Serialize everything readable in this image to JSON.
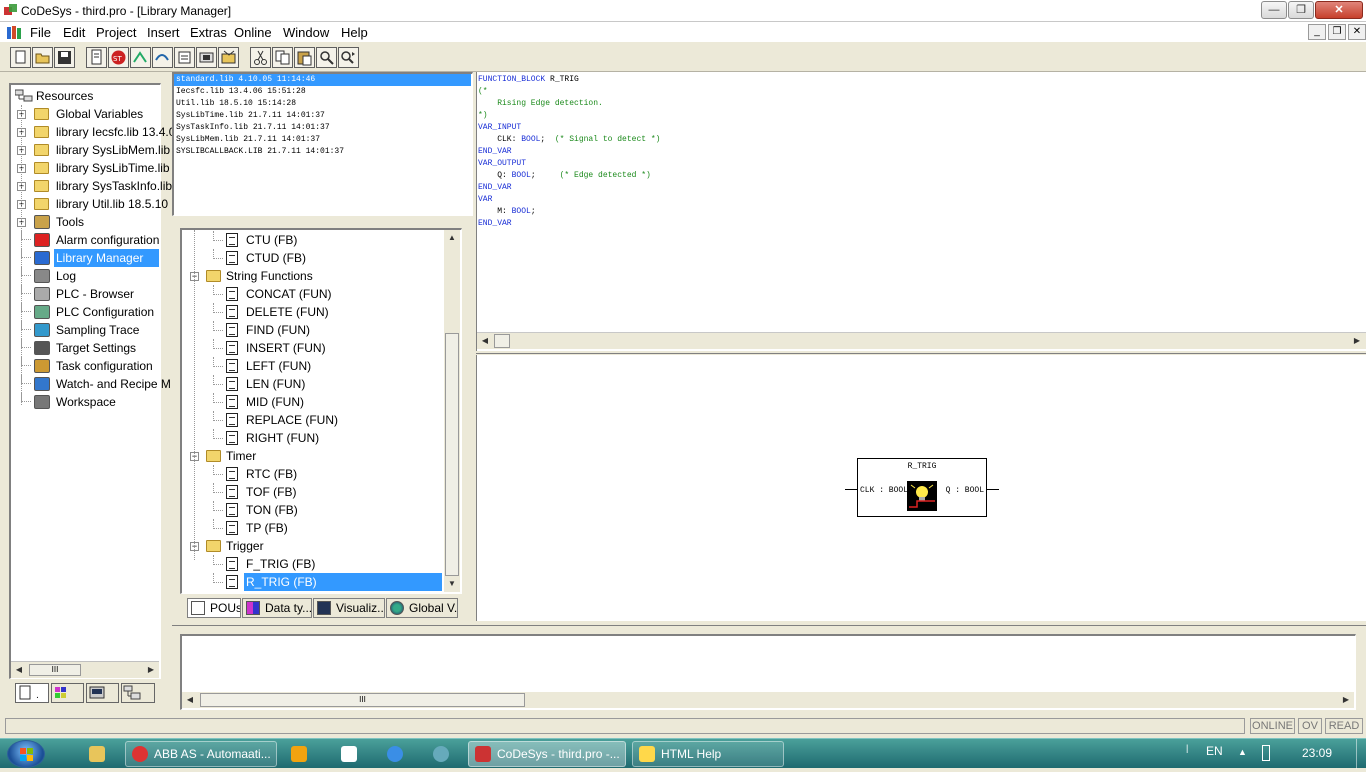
{
  "window": {
    "title": "CoDeSys - third.pro - [Library Manager]",
    "minimize_label": "—",
    "restore_label": "❐",
    "close_label": "✕"
  },
  "menubar": {
    "items": [
      "File",
      "Edit",
      "Project",
      "Insert",
      "Extras",
      "Online",
      "Window",
      "Help"
    ],
    "mdi_minimize": "_",
    "mdi_restore": "❐",
    "mdi_close": "✕"
  },
  "toolbar": {
    "buttons": [
      "new-file",
      "open-file",
      "save",
      "compile",
      "stop",
      "step-in",
      "step-over",
      "breakpoint",
      "toggle-breakpoint",
      "cut",
      "copy",
      "paste",
      "find",
      "find-next"
    ]
  },
  "resources": {
    "root_label": "Resources",
    "items": [
      {
        "label": "Global Variables",
        "expandable": true,
        "icon": "folder-icon"
      },
      {
        "label": "library Iecsfc.lib 13.4.0",
        "expandable": true,
        "icon": "folder-icon"
      },
      {
        "label": "library SysLibMem.lib 2",
        "expandable": true,
        "icon": "folder-icon"
      },
      {
        "label": "library SysLibTime.lib 2",
        "expandable": true,
        "icon": "folder-icon"
      },
      {
        "label": "library SysTaskInfo.lib",
        "expandable": true,
        "icon": "folder-icon"
      },
      {
        "label": "library Util.lib 18.5.10 1",
        "expandable": true,
        "icon": "folder-icon"
      },
      {
        "label": "Tools",
        "expandable": true,
        "icon": "tools-icon"
      },
      {
        "label": "Alarm configuration",
        "expandable": false,
        "icon": "alarm-icon"
      },
      {
        "label": "Library Manager",
        "expandable": false,
        "icon": "library-icon",
        "selected": true
      },
      {
        "label": "Log",
        "expandable": false,
        "icon": "log-icon"
      },
      {
        "label": "PLC - Browser",
        "expandable": false,
        "icon": "browser-icon"
      },
      {
        "label": "PLC Configuration",
        "expandable": false,
        "icon": "plc-config-icon"
      },
      {
        "label": "Sampling Trace",
        "expandable": false,
        "icon": "trace-icon"
      },
      {
        "label": "Target Settings",
        "expandable": false,
        "icon": "target-icon"
      },
      {
        "label": "Task configuration",
        "expandable": false,
        "icon": "task-icon"
      },
      {
        "label": "Watch- and Recipe M",
        "expandable": false,
        "icon": "watch-icon"
      },
      {
        "label": "Workspace",
        "expandable": false,
        "icon": "workspace-icon"
      }
    ],
    "hscroll_grip": "III"
  },
  "libraries": [
    "standard.lib 4.10.05 11:14:46",
    "Iecsfc.lib 13.4.06 15:51:28",
    "Util.lib 18.5.10 15:14:28",
    "SysLibTime.lib 21.7.11 14:01:37",
    "SysTaskInfo.lib 21.7.11 14:01:37",
    "SysLibMem.lib 21.7.11 14:01:37",
    "SYSLIBCALLBACK.LIB 21.7.11 14:01:37"
  ],
  "pou_tree": [
    {
      "kind": "item",
      "label": "CTU (FB)"
    },
    {
      "kind": "item",
      "label": "CTUD (FB)"
    },
    {
      "kind": "folder",
      "label": "String Functions"
    },
    {
      "kind": "item",
      "label": "CONCAT (FUN)"
    },
    {
      "kind": "item",
      "label": "DELETE (FUN)"
    },
    {
      "kind": "item",
      "label": "FIND (FUN)"
    },
    {
      "kind": "item",
      "label": "INSERT (FUN)"
    },
    {
      "kind": "item",
      "label": "LEFT (FUN)"
    },
    {
      "kind": "item",
      "label": "LEN (FUN)"
    },
    {
      "kind": "item",
      "label": "MID (FUN)"
    },
    {
      "kind": "item",
      "label": "REPLACE (FUN)"
    },
    {
      "kind": "item",
      "label": "RIGHT (FUN)"
    },
    {
      "kind": "folder",
      "label": "Timer"
    },
    {
      "kind": "item",
      "label": "RTC (FB)"
    },
    {
      "kind": "item",
      "label": "TOF (FB)"
    },
    {
      "kind": "item",
      "label": "TON (FB)"
    },
    {
      "kind": "item",
      "label": "TP (FB)"
    },
    {
      "kind": "folder",
      "label": "Trigger"
    },
    {
      "kind": "item",
      "label": "F_TRIG (FB)"
    },
    {
      "kind": "item",
      "label": "R_TRIG (FB)",
      "selected": true
    }
  ],
  "bottom_tabs": [
    "POUs",
    "Data ty...",
    "Visualiz...",
    "Global V..."
  ],
  "code": [
    [
      {
        "t": "FUNCTION_BLOCK",
        "c": "kw"
      },
      {
        "t": " R_TRIG",
        "c": ""
      }
    ],
    [
      {
        "t": "(*",
        "c": "cm"
      }
    ],
    [
      {
        "t": "    Rising Edge detection.",
        "c": "cm"
      }
    ],
    [
      {
        "t": "*)",
        "c": "cm"
      }
    ],
    [
      {
        "t": "VAR_INPUT",
        "c": "kw"
      }
    ],
    [
      {
        "t": "    CLK: ",
        "c": ""
      },
      {
        "t": "BOOL",
        "c": "kw"
      },
      {
        "t": ";  ",
        "c": ""
      },
      {
        "t": "(* Signal to detect *)",
        "c": "cm"
      }
    ],
    [
      {
        "t": "END_VAR",
        "c": "kw"
      }
    ],
    [
      {
        "t": "VAR_OUTPUT",
        "c": "kw"
      }
    ],
    [
      {
        "t": "    Q: ",
        "c": ""
      },
      {
        "t": "BOOL",
        "c": "kw"
      },
      {
        "t": ";     ",
        "c": ""
      },
      {
        "t": "(* Edge detected *)",
        "c": "cm"
      }
    ],
    [
      {
        "t": "END_VAR",
        "c": "kw"
      }
    ],
    [
      {
        "t": "VAR",
        "c": "kw"
      }
    ],
    [
      {
        "t": "    M: ",
        "c": ""
      },
      {
        "t": "BOOL",
        "c": "kw"
      },
      {
        "t": ";",
        "c": ""
      }
    ],
    [
      {
        "t": "END_VAR",
        "c": "kw"
      }
    ]
  ],
  "fb_block": {
    "name": "R_TRIG",
    "input": "CLK : BOOL",
    "output": "Q : BOOL"
  },
  "status": {
    "online": "ONLINE",
    "ov": "OV",
    "read": "READ"
  },
  "taskbar": {
    "tasks": [
      {
        "label": "",
        "icon": "explorer-icon"
      },
      {
        "label": "ABB AS - Automaati...",
        "icon": "chrome-icon"
      },
      {
        "label": "",
        "icon": "outlook-icon"
      },
      {
        "label": "",
        "icon": "paint-icon"
      },
      {
        "label": "",
        "icon": "ie-icon"
      },
      {
        "label": "",
        "icon": "rss-icon"
      },
      {
        "label": "CoDeSys - third.pro -...",
        "icon": "codesys-icon",
        "active": true
      },
      {
        "label": "HTML Help",
        "icon": "help-icon"
      }
    ],
    "lang": "EN",
    "time": "23:09"
  }
}
